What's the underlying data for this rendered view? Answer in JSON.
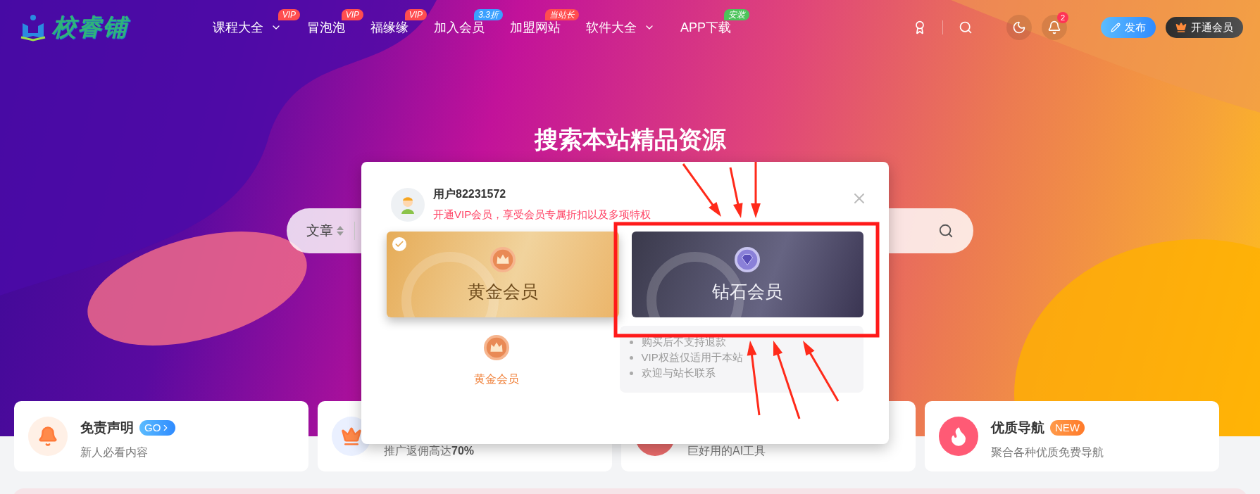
{
  "header": {
    "logo": "校睿铺",
    "nav": [
      {
        "label": "课程大全",
        "badge": {
          "text": "VIP",
          "kind": "vip"
        },
        "dropdown": true
      },
      {
        "label": "冒泡泡",
        "badge": {
          "text": "VIP",
          "kind": "vip"
        },
        "dropdown": false
      },
      {
        "label": "福缘缘",
        "badge": {
          "text": "VIP",
          "kind": "vip"
        },
        "dropdown": false
      },
      {
        "label": "加入会员",
        "badge": {
          "text": "3.3折",
          "kind": "sale"
        },
        "dropdown": false
      },
      {
        "label": "加盟网站",
        "badge": {
          "text": "当站长",
          "kind": "vip"
        },
        "dropdown": false
      },
      {
        "label": "软件大全",
        "dropdown": true
      },
      {
        "label": "APP下载",
        "badge": {
          "text": "安装",
          "kind": "install"
        },
        "dropdown": false
      }
    ],
    "notification_count": "2",
    "buttons": [
      {
        "label": "发布",
        "kind": "publish"
      },
      {
        "label": "开通会员",
        "kind": "vip"
      }
    ]
  },
  "hero": {
    "title": "搜索本站精品资源",
    "search": {
      "category": "文章"
    }
  },
  "cards": [
    {
      "kind": "bell",
      "title": "免责声明",
      "tag": {
        "text": "GO",
        "kind": "go"
      },
      "subtitle": "新人必看内容"
    },
    {
      "kind": "crown",
      "subtitle": "推广返佣高达**70%**"
    },
    {
      "kind": "dot",
      "subtitle": "巨好用的AI工具"
    },
    {
      "kind": "fire",
      "title": "优质导航",
      "tag": {
        "text": "NEW",
        "kind": "new"
      },
      "subtitle": "聚合各种优质免费导航"
    }
  ],
  "modal": {
    "username": "用户82231572",
    "subtitle": "开通VIP会员，享受会员专属折扣以及多项特权",
    "plans": [
      {
        "name": "黄金会员",
        "kind": "gold",
        "selected": true
      },
      {
        "name": "钻石会员",
        "kind": "diamond",
        "selected": false
      }
    ],
    "current_plan": "黄金会员",
    "notes": [
      "购买后不支持退款",
      "VIP权益仅适用于本站",
      "欢迎与站长联系"
    ]
  }
}
